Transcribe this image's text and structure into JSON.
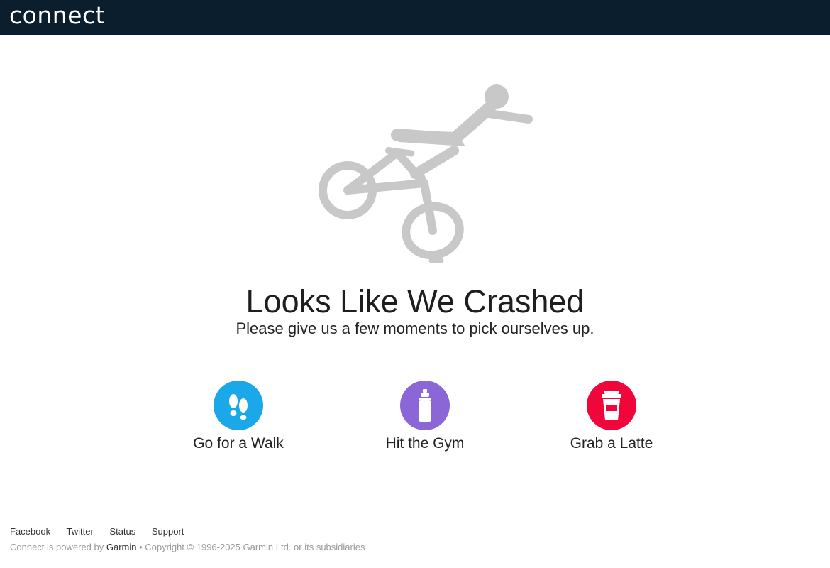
{
  "header": {
    "logo_text": "connect",
    "background_color": "#0b1e2d"
  },
  "main": {
    "illustration_icon": "crashed-cyclist-icon",
    "title": "Looks Like We Crashed",
    "subtitle": "Please give us a few moments to pick ourselves up.",
    "options": [
      {
        "label": "Go for a Walk",
        "icon": "footprints-icon",
        "color": "#1ba8e8"
      },
      {
        "label": "Hit the Gym",
        "icon": "water-bottle-icon",
        "color": "#8a66d6"
      },
      {
        "label": "Grab a Latte",
        "icon": "coffee-cup-icon",
        "color": "#f0063a"
      }
    ]
  },
  "footer": {
    "links": [
      "Facebook",
      "Twitter",
      "Status",
      "Support"
    ],
    "powered_prefix": "Connect is powered by",
    "brand": "Garmin",
    "copyright": "• Copyright © 1996-2025 Garmin Ltd. or its subsidiaries"
  }
}
